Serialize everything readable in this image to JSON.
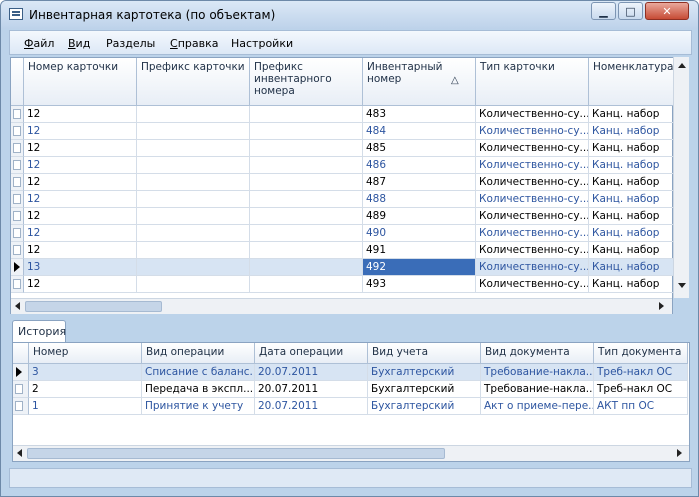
{
  "window": {
    "title": "Инвентарная картотека (по объектам)",
    "controls": {
      "minimize": "▁",
      "maximize": "□",
      "close": "✕"
    }
  },
  "menu": [
    {
      "label": "Файл",
      "key": "Ф",
      "rest": "айл"
    },
    {
      "label": "Вид",
      "key": "В",
      "rest": "ид"
    },
    {
      "label": "Разделы",
      "key": "",
      "rest": "Разделы"
    },
    {
      "label": "Справка",
      "key": "С",
      "rest": "правка"
    },
    {
      "label": "Настройки",
      "key": "",
      "rest": "Настройки"
    }
  ],
  "cards_grid": {
    "columns": [
      "Номер карточки",
      "Префикс карточки",
      "Префикс инвентарного номера",
      "Инвентарный номер",
      "Тип карточки",
      "Номенклатура"
    ],
    "sort_indicator": "△",
    "rows": [
      {
        "num": "12",
        "prefix": "",
        "inv_prefix": "",
        "inv": "483",
        "type": "Количественно-су...",
        "nom": "Канц. набор"
      },
      {
        "num": "12",
        "prefix": "",
        "inv_prefix": "",
        "inv": "484",
        "type": "Количественно-су...",
        "nom": "Канц. набор"
      },
      {
        "num": "12",
        "prefix": "",
        "inv_prefix": "",
        "inv": "485",
        "type": "Количественно-су...",
        "nom": "Канц. набор"
      },
      {
        "num": "12",
        "prefix": "",
        "inv_prefix": "",
        "inv": "486",
        "type": "Количественно-су...",
        "nom": "Канц. набор"
      },
      {
        "num": "12",
        "prefix": "",
        "inv_prefix": "",
        "inv": "487",
        "type": "Количественно-су...",
        "nom": "Канц. набор"
      },
      {
        "num": "12",
        "prefix": "",
        "inv_prefix": "",
        "inv": "488",
        "type": "Количественно-су...",
        "nom": "Канц. набор"
      },
      {
        "num": "12",
        "prefix": "",
        "inv_prefix": "",
        "inv": "489",
        "type": "Количественно-су...",
        "nom": "Канц. набор"
      },
      {
        "num": "12",
        "prefix": "",
        "inv_prefix": "",
        "inv": "490",
        "type": "Количественно-су...",
        "nom": "Канц. набор"
      },
      {
        "num": "12",
        "prefix": "",
        "inv_prefix": "",
        "inv": "491",
        "type": "Количественно-су...",
        "nom": "Канц. набор"
      },
      {
        "num": "13",
        "prefix": "",
        "inv_prefix": "",
        "inv": "492",
        "type": "Количественно-су...",
        "nom": "Канц. набор"
      },
      {
        "num": "12",
        "prefix": "",
        "inv_prefix": "",
        "inv": "493",
        "type": "Количественно-су...",
        "nom": "Канц. набор"
      }
    ],
    "selected_row": 9
  },
  "history_tab": {
    "label": "История"
  },
  "history_grid": {
    "columns": [
      "Номер",
      "Вид операции",
      "Дата операции",
      "Вид учета",
      "Вид документа",
      "Тип документа"
    ],
    "rows": [
      {
        "num": "3",
        "op": "Списание с баланс...",
        "date": "20.07.2011",
        "acc": "Бухгалтерский",
        "doc": "Требование-накла...",
        "dtype": "Треб-накл ОС"
      },
      {
        "num": "2",
        "op": "Передача в экспл...",
        "date": "20.07.2011",
        "acc": "Бухгалтерский",
        "doc": "Требование-накла...",
        "dtype": "Треб-накл ОС"
      },
      {
        "num": "1",
        "op": "Принятие к учету",
        "date": "20.07.2011",
        "acc": "Бухгалтерский",
        "doc": "Акт о приеме-пере...",
        "dtype": "АКТ пп ОС"
      }
    ],
    "selected_row": 0
  }
}
